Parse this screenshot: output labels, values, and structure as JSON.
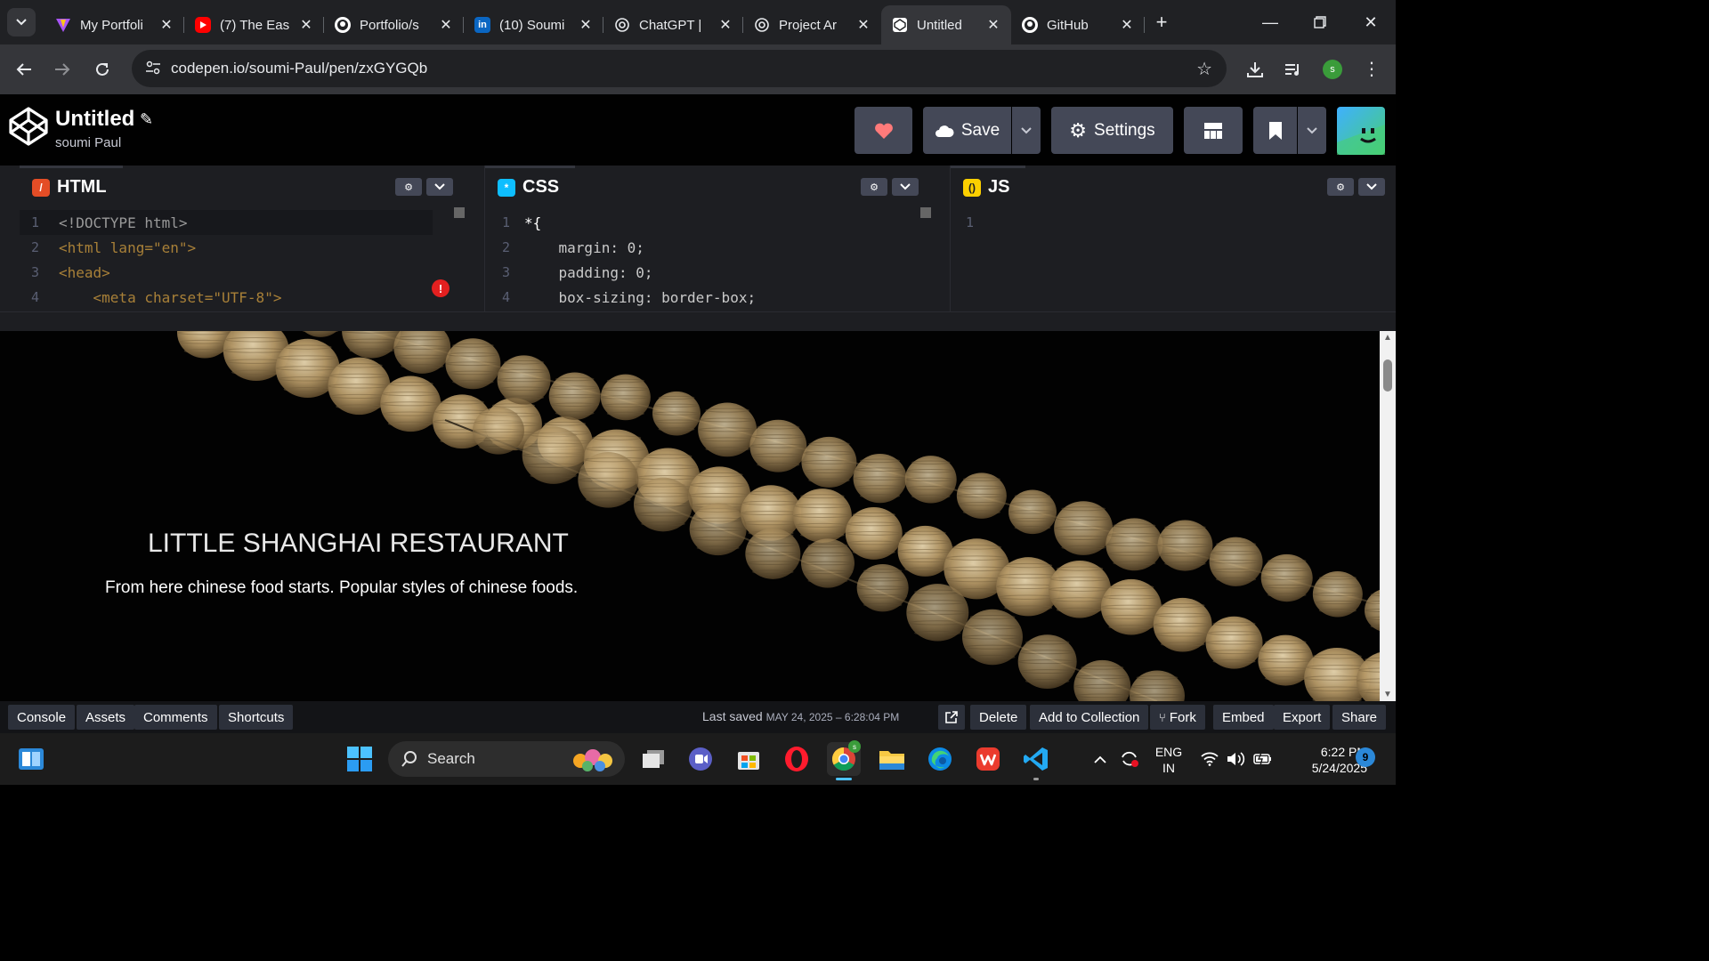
{
  "browser": {
    "tabs": [
      {
        "label": "My Portfoli",
        "icon": "vite-icon",
        "color": "#a855f7"
      },
      {
        "label": "(7) The Eas",
        "icon": "youtube-icon",
        "color": "#ff0000"
      },
      {
        "label": "Portfolio/s",
        "icon": "github-icon",
        "color": "#ffffff"
      },
      {
        "label": "(10) Soumi",
        "icon": "linkedin-icon",
        "color": "#0a66c2"
      },
      {
        "label": "ChatGPT | ",
        "icon": "chatgpt-icon",
        "color": "#ffffff"
      },
      {
        "label": "Project Ar",
        "icon": "chatgpt-icon",
        "color": "#ffffff"
      },
      {
        "label": "Untitled",
        "icon": "codepen-icon",
        "color": "#ffffff",
        "active": true
      },
      {
        "label": "GitHub",
        "icon": "github-icon",
        "color": "#ffffff"
      }
    ],
    "url": "codepen.io/soumi-Paul/pen/zxGYGQb",
    "profile_initial": "s"
  },
  "codepen": {
    "title": "Untitled",
    "user": "soumi Paul",
    "save_label": "Save",
    "settings_label": "Settings",
    "panes": {
      "html": {
        "label": "HTML",
        "color": "#e44d26"
      },
      "css": {
        "label": "CSS",
        "color": "#0ebeff"
      },
      "js": {
        "label": "JS",
        "color": "#fcd000"
      }
    }
  },
  "code": {
    "html": [
      {
        "n": "1",
        "text": "<!DOCTYPE html>"
      },
      {
        "n": "2",
        "text": "<html lang=\"en\">"
      },
      {
        "n": "3",
        "text": "<head>"
      },
      {
        "n": "4",
        "text": "    <meta charset=\"UTF-8\">"
      }
    ],
    "css": [
      {
        "n": "1",
        "text": "*{"
      },
      {
        "n": "2",
        "text": "    margin: 0;"
      },
      {
        "n": "3",
        "text": "    padding: 0;"
      },
      {
        "n": "4",
        "text": "    box-sizing: border-box;"
      }
    ],
    "js": [
      {
        "n": "1",
        "text": ""
      }
    ]
  },
  "preview": {
    "title": "LITTLE SHANGHAI RESTAURANT",
    "subtitle": "From here chinese food starts. Popular styles of chinese foods."
  },
  "footer": {
    "left_buttons": [
      "Console",
      "Assets",
      "Comments",
      "Shortcuts"
    ],
    "last_saved_label": "Last saved",
    "last_saved_value": "MAY 24, 2025 – 6:28:04 PM",
    "right_buttons": [
      "Delete",
      "Add to Collection",
      "Fork",
      "Embed",
      "Export",
      "Share"
    ]
  },
  "taskbar": {
    "search_label": "Search",
    "lang_line1": "ENG",
    "lang_line2": "IN",
    "time": "6:22 PM",
    "date": "5/24/2025",
    "notifications": "9"
  }
}
